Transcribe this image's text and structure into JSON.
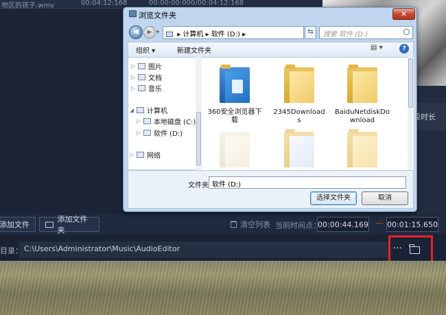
{
  "background_app": {
    "top_row": {
      "file_name": "地区的孩子.wmv",
      "duration": "00:04:12:168",
      "range": "00:00:00:000/00:04:12:168"
    },
    "right_header": "段时长",
    "toolbar": {
      "add_file": "添加文件",
      "add_folder": "添加文件夹",
      "clear_list": "清空列表",
      "current_time_label": "当前时间点：",
      "time_start": "00:00:44.169",
      "time_sep": "—",
      "time_end": "00:01:15.650"
    },
    "output": {
      "label": "目录：",
      "path": "C:\\Users\\Administrator\\Music\\AudioEditor",
      "more": "···"
    }
  },
  "dialog": {
    "title": "浏览文件夹",
    "close": "✕",
    "address": {
      "sep1": "▸",
      "computer": "计算机",
      "sep2": "▸",
      "drive": "软件 (D:)",
      "sep3": "▸"
    },
    "search_placeholder": "搜索 软件 (D:)",
    "toolbar": {
      "organize": "组织 ▾",
      "new_folder": "新建文件夹",
      "view": "▤ ▾",
      "help": "?"
    },
    "nav": [
      {
        "label": "图片",
        "arrow": "▷"
      },
      {
        "label": "文档",
        "arrow": "▷"
      },
      {
        "label": "音乐",
        "arrow": "▷"
      },
      {
        "label": "计算机",
        "arrow": "◢"
      },
      {
        "label": "本地磁盘 (C:)",
        "arrow": "▷"
      },
      {
        "label": "软件 (D:)",
        "arrow": "▷"
      },
      {
        "label": "网络",
        "arrow": "▷"
      }
    ],
    "folders": [
      {
        "label": "360安全浏览器下载"
      },
      {
        "label": "2345Downloads"
      },
      {
        "label": "BaiduNetdiskDownload"
      }
    ],
    "folder_label": "文件夹:",
    "folder_value": "软件 (D:)",
    "select_button": "选择文件夹",
    "cancel_button": "取消"
  },
  "colors": {
    "highlight": "#e8222a",
    "app_bg": "#1c2537",
    "dialog_frame": "#bfd6ee"
  }
}
